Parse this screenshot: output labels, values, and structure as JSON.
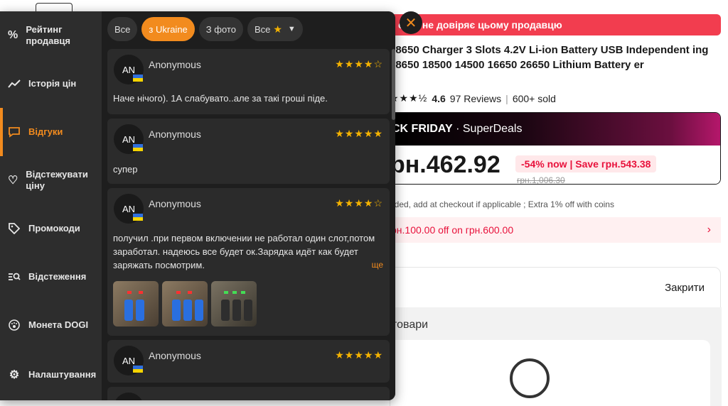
{
  "page": {
    "warning": "ерег не довіряє цьому продавцю",
    "product_title": "18650 Charger 3 Slots 4.2V Li-ion Battery USB Independent ing 18650 18500 14500 16650 26650 Lithium Battery er",
    "rating_stars": "★★★½",
    "rating_score": "4.6",
    "reviews_count": "97 Reviews",
    "sold": "600+ sold",
    "deal_prefix": "CK FRIDAY",
    "deal_suffix": "· SuperDeals",
    "price": "рн.462.92",
    "discount": "-54% now | Save грн.543.38",
    "old_price": "грн.1,006.30",
    "tax_note": "uded, add at checkout if applicable ; Extra 1% off with coins",
    "coupon": "рн.100.00 off on грн.600.00",
    "close_link": "Закрити",
    "section_label": "товари"
  },
  "sidebar": {
    "items": [
      {
        "label": "Рейтинг продавця",
        "icon": "percent-icon"
      },
      {
        "label": "Історія цін",
        "icon": "trend-icon"
      },
      {
        "label": "Відгуки",
        "icon": "chat-icon",
        "active": true
      },
      {
        "label": "Відстежувати ціну",
        "icon": "heart-icon"
      },
      {
        "label": "Промокоди",
        "icon": "tag-icon"
      },
      {
        "label": "Відстеження",
        "icon": "track-search-icon"
      },
      {
        "label": "Монета DOGI",
        "icon": "paw-coin-icon"
      },
      {
        "label": "Налаштування",
        "icon": "gear-icon"
      }
    ]
  },
  "filters": {
    "all": "Все",
    "ukraine": "з Ukraine",
    "photo": "З фото",
    "rating": "Все"
  },
  "reviews": [
    {
      "initials": "AN",
      "author": "Anonymous",
      "stars": "★★★★☆",
      "text": "Наче нічого). 1А слабувато..але за такі гроші піде."
    },
    {
      "initials": "AN",
      "author": "Anonymous",
      "stars": "★★★★★",
      "text": "супер"
    },
    {
      "initials": "AN",
      "author": "Anonymous",
      "stars": "★★★★☆",
      "text": "получил .при первом включении не работал один слот,потом заработал. надеюсь все будет ок.Зарядка идёт как будет заряжать посмотрим.",
      "more": "ще"
    },
    {
      "initials": "AN",
      "author": "Anonymous",
      "stars": "★★★★★",
      "text": ""
    }
  ],
  "colors": {
    "accent": "#f28b1e",
    "star": "#f5b301",
    "panel": "#1e1e1e",
    "sidebar": "#2d2d2d",
    "warning": "#f23d4f"
  }
}
